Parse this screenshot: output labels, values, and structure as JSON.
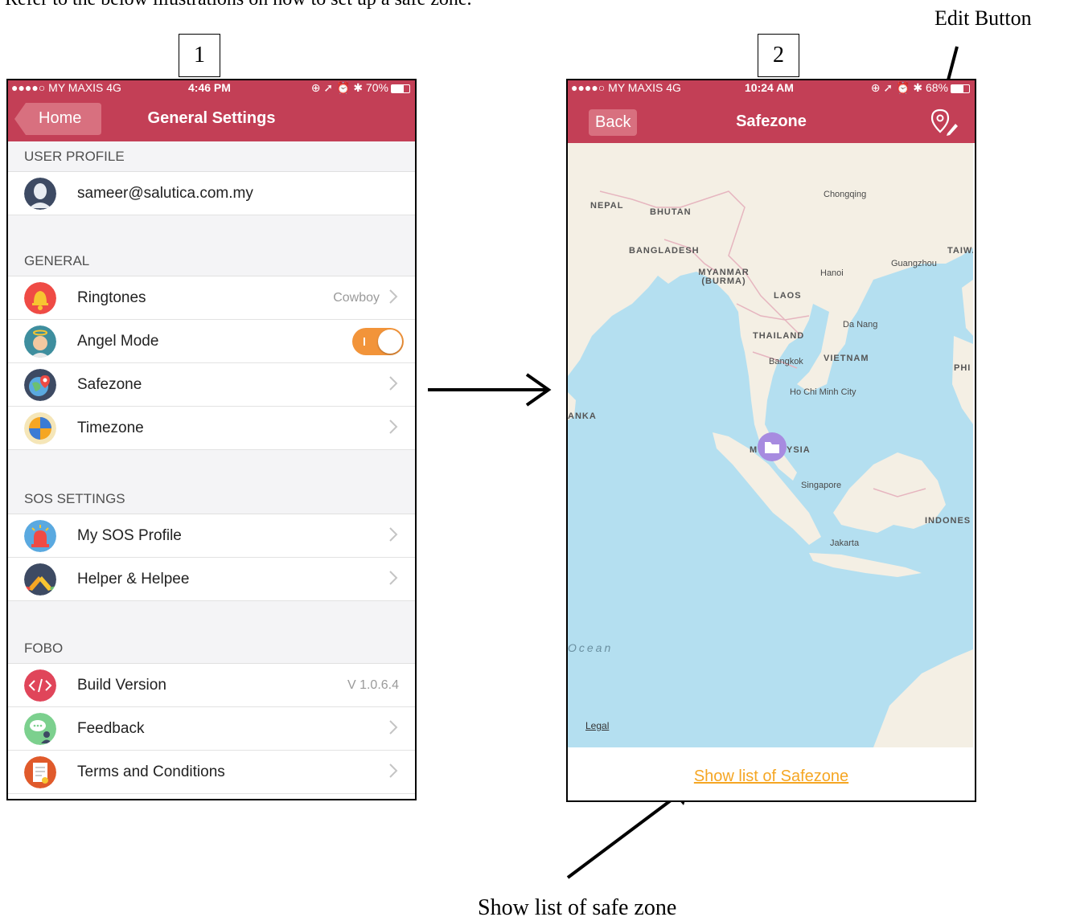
{
  "instructions": "Refer to the below illustrations on how to set up a safe zone.",
  "annotations": {
    "edit_button": "Edit Button",
    "show_list": "Show list of safe zone",
    "step1": "1",
    "step2": "2"
  },
  "screen1": {
    "status": {
      "carrier": "●●●●○ MY MAXIS  4G",
      "time": "4:46 PM",
      "right": "⊕ ➚ ⏰ ✱ 70%"
    },
    "nav": {
      "back": "Home",
      "title": "General Settings"
    },
    "sections": {
      "user_profile": "USER PROFILE",
      "general": "GENERAL",
      "sos": "SOS SETTINGS",
      "fobo": "FOBO"
    },
    "email": "sameer@salutica.com.my",
    "ringtones": {
      "label": "Ringtones",
      "value": "Cowboy"
    },
    "angel_mode": {
      "label": "Angel Mode",
      "on": true
    },
    "safezone": "Safezone",
    "timezone": "Timezone",
    "sos_profile": "My SOS Profile",
    "helper": "Helper & Helpee",
    "build": {
      "label": "Build Version",
      "value": "V 1.0.6.4"
    },
    "feedback": "Feedback",
    "terms": "Terms and Conditions",
    "colors": {
      "accent": "#c33f56",
      "toggle": "#f2943a"
    }
  },
  "screen2": {
    "status": {
      "carrier": "●●●●○ MY MAXIS  4G",
      "time": "10:24 AM",
      "right": "⊕ ➚ ⏰ ✱ 68%"
    },
    "nav": {
      "back": "Back",
      "title": "Safezone"
    },
    "map_labels": {
      "chongqing": "Chongqing",
      "nepal": "NEPAL",
      "bhutan": "BHUTAN",
      "bangladesh": "BANGLADESH",
      "guangzhou": "Guangzhou",
      "taiwan": "TAIWA",
      "myanmar": "MYANMAR (BURMA)",
      "hanoi": "Hanoi",
      "laos": "LAOS",
      "danang": "Da Nang",
      "thailand": "THAILAND",
      "bangkok": "Bangkok",
      "vietnam": "VIETNAM",
      "phi": "PHI",
      "hcmc": "Ho Chi Minh City",
      "lanka": "ANKA",
      "malaysia": "YSIA",
      "malaysia_m": "M",
      "singapore": "Singapore",
      "indonesia": "INDONES",
      "jakarta": "Jakarta",
      "ocean": "Ocean"
    },
    "legal": "Legal",
    "show_list": "Show list of Safezone"
  }
}
